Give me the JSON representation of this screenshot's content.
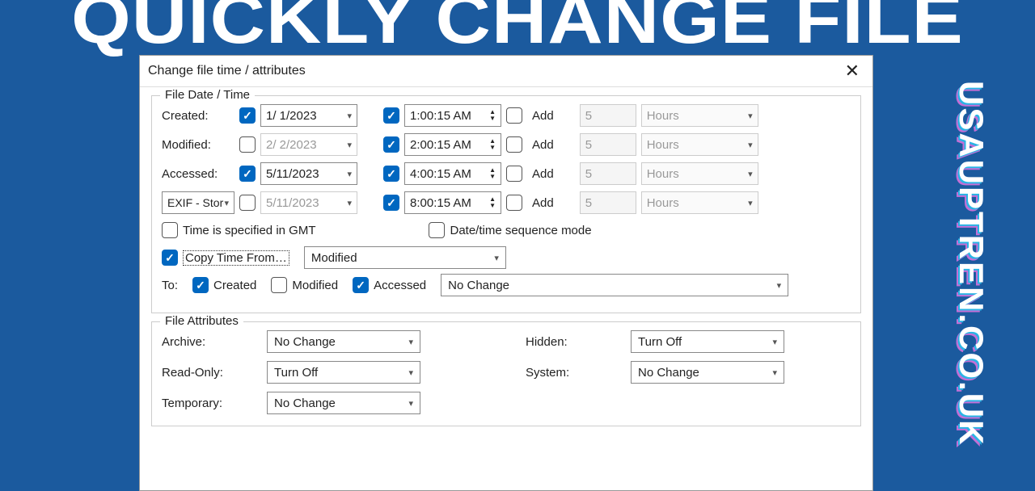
{
  "banner": "QUICKLY CHANGE FILE ATTRIBUTES",
  "brand": "USAUPTREN.CO.UK",
  "title": "Change file time / attributes",
  "group1": "File Date / Time",
  "labels": {
    "created": "Created:",
    "modified": "Modified:",
    "accessed": "Accessed:",
    "add": "Add"
  },
  "rows": [
    {
      "dateChecked": true,
      "date": "1/ 1/2023",
      "timeChecked": true,
      "time": "1:00:15 AM",
      "addChecked": false,
      "num": "5",
      "unit": "Hours"
    },
    {
      "dateChecked": false,
      "date": "2/ 2/2023",
      "timeChecked": true,
      "time": "2:00:15 AM",
      "addChecked": false,
      "num": "5",
      "unit": "Hours"
    },
    {
      "dateChecked": true,
      "date": "5/11/2023",
      "timeChecked": true,
      "time": "4:00:15 AM",
      "addChecked": false,
      "num": "5",
      "unit": "Hours"
    },
    {
      "dateChecked": false,
      "date": "5/11/2023",
      "timeChecked": true,
      "time": "8:00:15 AM",
      "addChecked": false,
      "num": "5",
      "unit": "Hours"
    }
  ],
  "exifLabel": "EXIF - Stored Time",
  "gmt": "Time is specified in GMT",
  "seq": "Date/time sequence mode",
  "copyFromChecked": true,
  "copyFrom": "Copy Time From…",
  "copySource": "Modified",
  "toLabel": "To:",
  "to": {
    "createdChecked": true,
    "created": "Created",
    "modifiedChecked": false,
    "modified": "Modified",
    "accessedChecked": true,
    "accessed": "Accessed"
  },
  "noChange": "No Change",
  "group2": "File Attributes",
  "attrLabels": {
    "archive": "Archive:",
    "hidden": "Hidden:",
    "readonly": "Read-Only:",
    "system": "System:",
    "temporary": "Temporary:"
  },
  "attrValues": {
    "archive": "No Change",
    "hidden": "Turn Off",
    "readonly": "Turn Off",
    "system": "No Change",
    "temporary": "No Change"
  }
}
